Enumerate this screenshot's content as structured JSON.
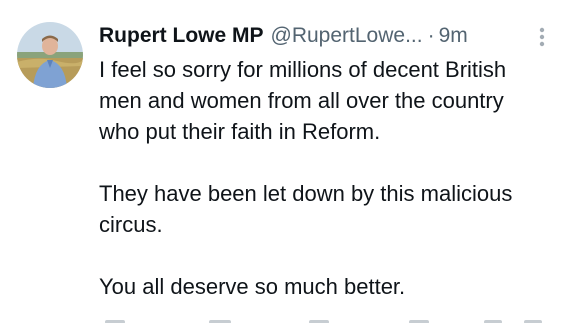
{
  "tweet": {
    "author": {
      "name": "Rupert Lowe MP",
      "handle": "@RupertLowe...",
      "avatar_icon": "profile-photo"
    },
    "separator": "·",
    "timestamp": "9m",
    "more_icon": "more-vertical-icon",
    "paragraphs": [
      "I feel so sorry for millions of decent British men and women from all over the country who put their faith in Reform.",
      "They have been let down by this malicious circus.",
      "You all deserve so much better."
    ]
  },
  "colors": {
    "text_primary": "#0f1419",
    "text_secondary": "#536471",
    "background": "#ffffff"
  }
}
